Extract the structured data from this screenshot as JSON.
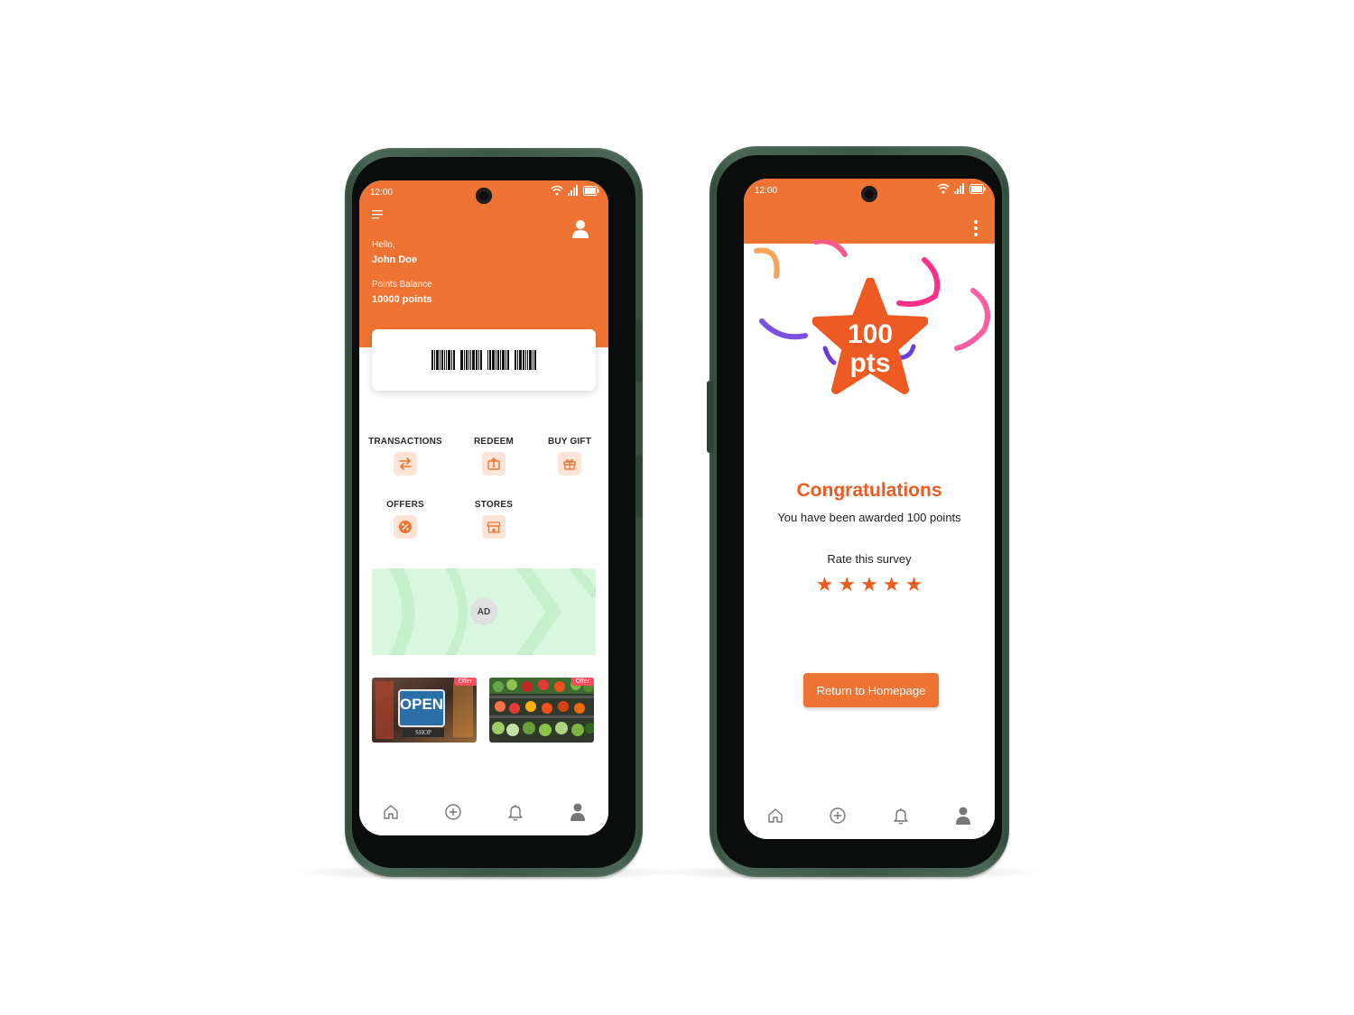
{
  "home": {
    "status_time": "12:00",
    "greeting": "Hello,",
    "user_name": "John Doe",
    "balance_label": "Points Balance",
    "balance_value": "10000 points",
    "actions": [
      {
        "label": "TRANSACTIONS",
        "icon": "transfer-icon"
      },
      {
        "label": "REDEEM",
        "icon": "redeem-icon"
      },
      {
        "label": "BUY GIFT",
        "icon": "gift-icon"
      },
      {
        "label": "OFFERS",
        "icon": "offer-percent-icon"
      },
      {
        "label": "STORES",
        "icon": "store-icon"
      }
    ],
    "ad_label": "AD",
    "offers": [
      {
        "tag": "Offer",
        "sign_text": "OPEN",
        "sign_sub": "SHOP"
      },
      {
        "tag": "Offer"
      }
    ],
    "nav": [
      "home-icon",
      "add-circle-icon",
      "bell-icon",
      "profile-icon"
    ]
  },
  "congrats": {
    "status_time": "12:00",
    "badge_value": "100",
    "badge_unit": "pts",
    "title": "Congratulations",
    "message": "You have been awarded 100 points",
    "rate_label": "Rate this survey",
    "rating": 5,
    "stars": [
      "★",
      "★",
      "★",
      "★",
      "★"
    ],
    "button_label": "Return to Homepage",
    "nav": [
      "home-icon",
      "add-circle-icon",
      "bell-icon",
      "profile-icon"
    ]
  },
  "colors": {
    "brand_orange": "#ef7433",
    "accent_red_orange": "#ee5a1f",
    "phone_frame": "#3d5849",
    "ad_green": "#d9f6de"
  }
}
